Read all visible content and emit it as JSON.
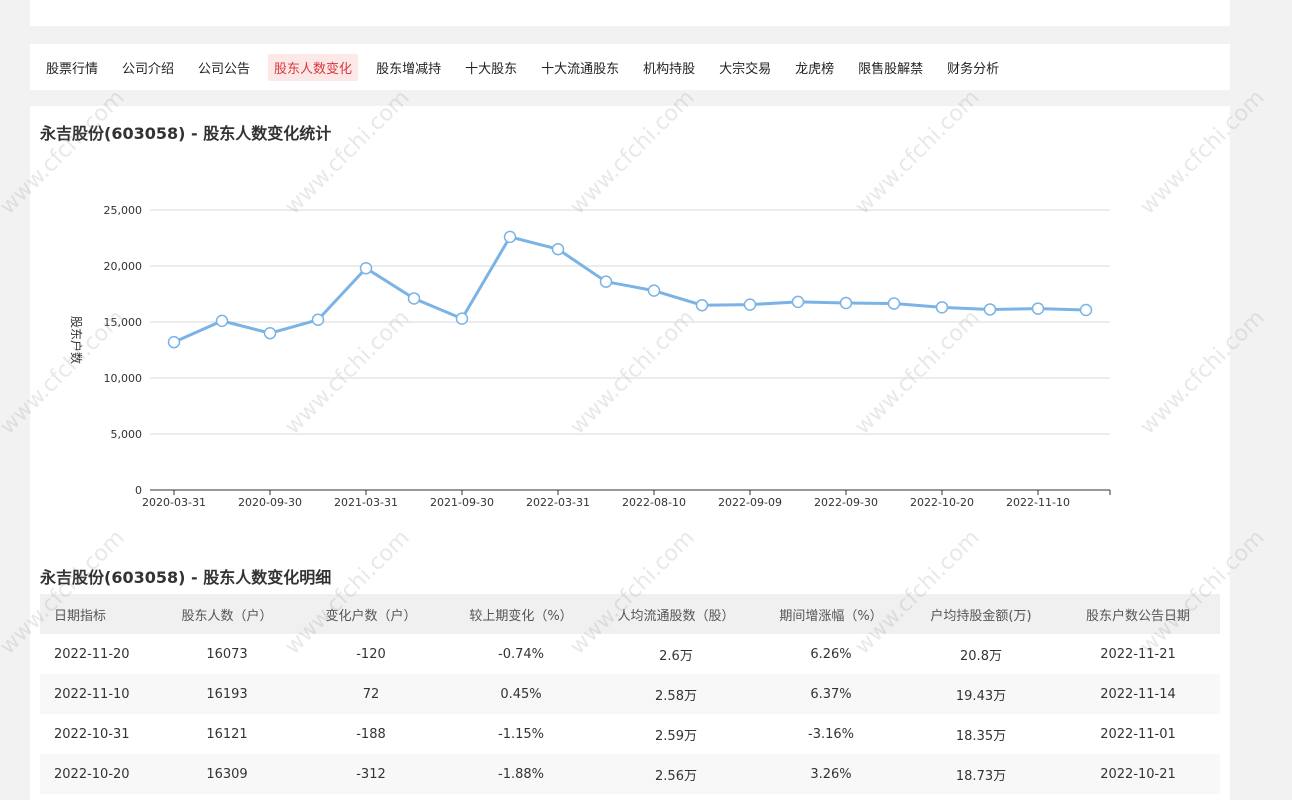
{
  "nav": {
    "items": [
      "股票行情",
      "公司介绍",
      "公司公告",
      "股东人数变化",
      "股东增减持",
      "十大股东",
      "十大流通股东",
      "机构持股",
      "大宗交易",
      "龙虎榜",
      "限售股解禁",
      "财务分析"
    ],
    "active_index": 3
  },
  "chart_section": {
    "title": "永吉股份(603058) - 股东人数变化统计"
  },
  "chart_data": {
    "type": "line",
    "ylabel": "股东户数",
    "ylim": [
      0,
      25000
    ],
    "yticks": [
      "0",
      "5,000",
      "10,000",
      "15,000",
      "20,000",
      "25,000"
    ],
    "ytick_values": [
      0,
      5000,
      10000,
      15000,
      20000,
      25000
    ],
    "xtick_labels": [
      "2020-03-31",
      "2020-09-30",
      "2021-03-31",
      "2021-09-30",
      "2022-03-31",
      "2022-08-10",
      "2022-09-09",
      "2022-09-30",
      "2022-10-20",
      "2022-11-10"
    ],
    "xtick_indices": [
      0,
      2,
      4,
      6,
      8,
      10,
      12,
      14,
      16,
      18
    ],
    "values": [
      13200,
      15100,
      14000,
      15200,
      19800,
      17100,
      15300,
      22600,
      21500,
      18600,
      17800,
      16500,
      16550,
      16800,
      16700,
      16650,
      16309,
      16121,
      16193,
      16073
    ],
    "line_color": "#7ab3e5",
    "grid": true
  },
  "detail": {
    "title": "永吉股份(603058) - 股东人数变化明细",
    "headers": [
      "日期指标",
      "股东人数（户）",
      "变化户数（户）",
      "较上期变化（%）",
      "人均流通股数（股）",
      "期间增涨幅（%）",
      "户均持股金额(万)",
      "股东户数公告日期"
    ],
    "rows": [
      [
        "2022-11-20",
        "16073",
        "-120",
        "-0.74%",
        "2.6万",
        "6.26%",
        "20.8万",
        "2022-11-21"
      ],
      [
        "2022-11-10",
        "16193",
        "72",
        "0.45%",
        "2.58万",
        "6.37%",
        "19.43万",
        "2022-11-14"
      ],
      [
        "2022-10-31",
        "16121",
        "-188",
        "-1.15%",
        "2.59万",
        "-3.16%",
        "18.35万",
        "2022-11-01"
      ],
      [
        "2022-10-20",
        "16309",
        "-312",
        "-1.88%",
        "2.56万",
        "3.26%",
        "18.73万",
        "2022-10-21"
      ]
    ],
    "colors": {
      "positive": "#e60012",
      "negative": "#39a43a"
    }
  },
  "watermark": {
    "text": "www.cfchi.com"
  }
}
